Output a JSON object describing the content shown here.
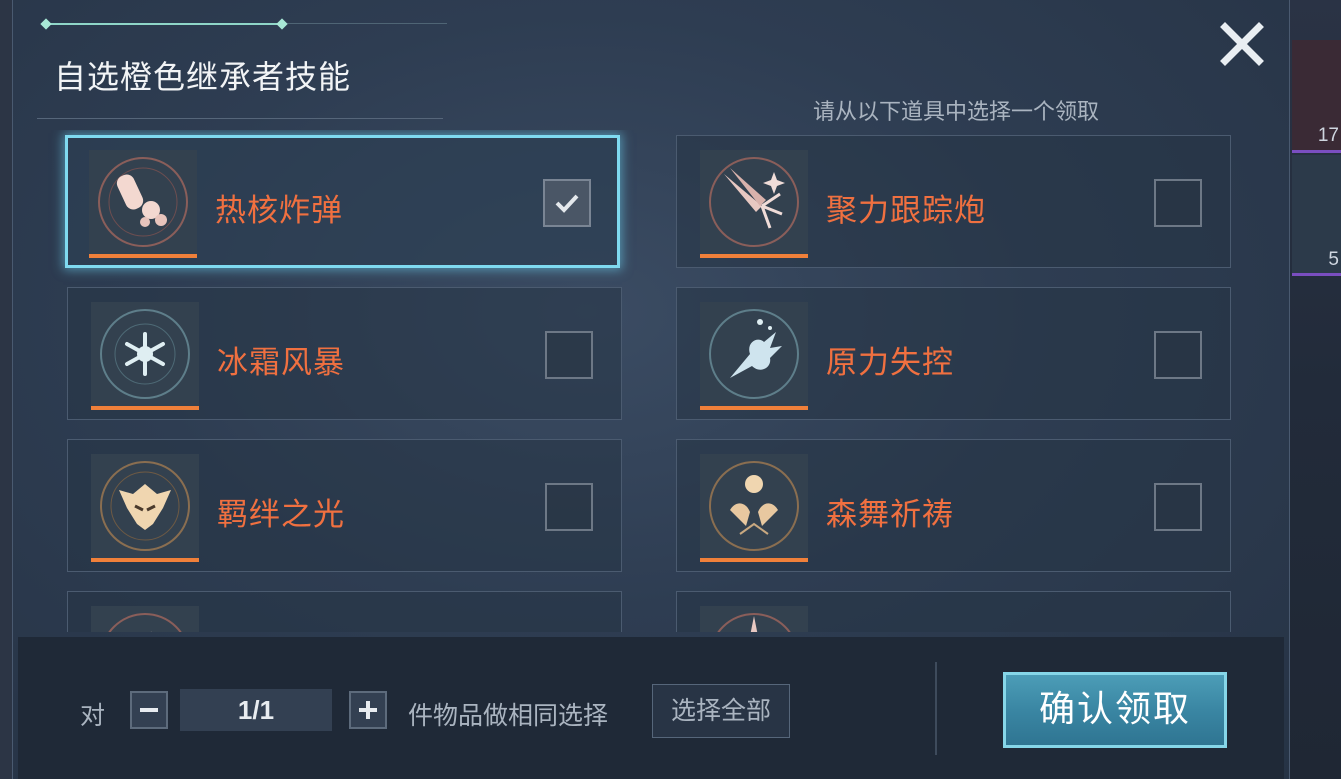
{
  "dialog": {
    "title": "自选橙色继承者技能",
    "instruction": "请从以下道具中选择一个领取",
    "close_icon": "close-icon"
  },
  "skills": [
    {
      "name": "热核炸弹",
      "selected": true,
      "icon": "thermonuclear-bomb-icon"
    },
    {
      "name": "聚力跟踪炮",
      "selected": false,
      "icon": "tracking-cannon-icon"
    },
    {
      "name": "冰霜风暴",
      "selected": false,
      "icon": "frost-storm-icon"
    },
    {
      "name": "原力失控",
      "selected": false,
      "icon": "force-runaway-icon"
    },
    {
      "name": "羁绊之光",
      "selected": false,
      "icon": "bond-light-icon"
    },
    {
      "name": "森舞祈祷",
      "selected": false,
      "icon": "forest-prayer-icon"
    }
  ],
  "footer": {
    "prefix": "对",
    "quantity": "1/1",
    "suffix": "件物品做相同选择",
    "select_all_label": "选择全部",
    "confirm_label": "确认领取",
    "minus_icon": "minus-icon",
    "plus_icon": "plus-icon"
  },
  "background": {
    "counts": [
      "17",
      "5"
    ]
  },
  "colors": {
    "skill_name": "#f07040",
    "rarity_bar": "#f0803a",
    "selected_border": "#7fdaf0",
    "confirm_button": "#3a86a3"
  }
}
